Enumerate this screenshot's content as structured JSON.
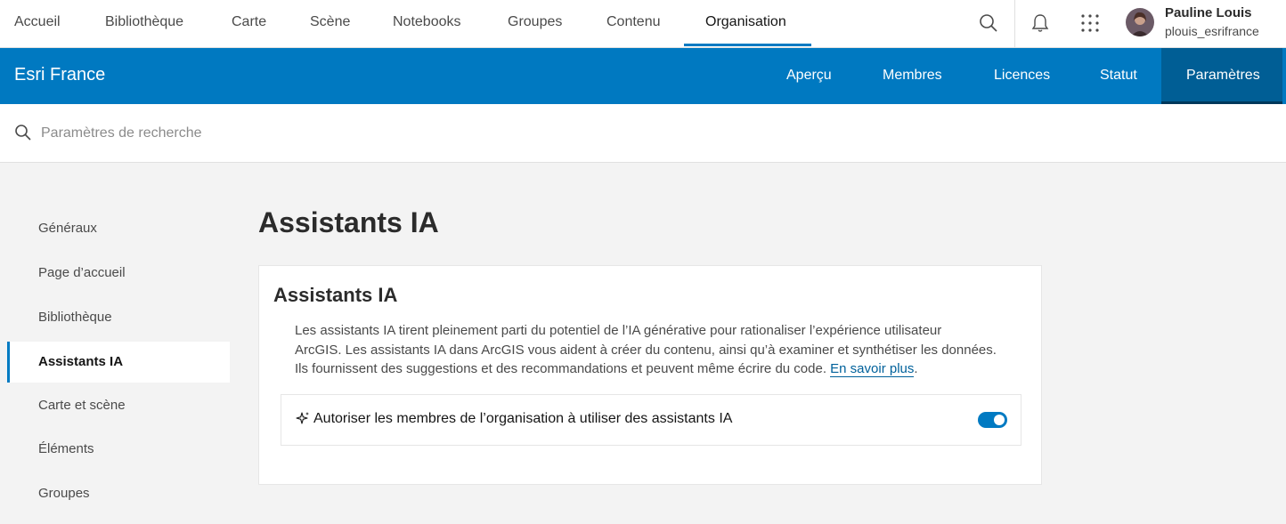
{
  "topnav": {
    "items": [
      {
        "label": "Accueil"
      },
      {
        "label": "Bibliothèque"
      },
      {
        "label": "Carte"
      },
      {
        "label": "Scène"
      },
      {
        "label": "Notebooks"
      },
      {
        "label": "Groupes"
      },
      {
        "label": "Contenu"
      },
      {
        "label": "Organisation",
        "active": true
      }
    ],
    "icons": [
      "search-icon",
      "bell-icon",
      "app-launcher-icon"
    ],
    "user": {
      "name": "Pauline Louis",
      "handle": "plouis_esrifrance"
    }
  },
  "org": {
    "title": "Esri France",
    "tabs": [
      {
        "label": "Aperçu"
      },
      {
        "label": "Membres"
      },
      {
        "label": "Licences"
      },
      {
        "label": "Statut"
      },
      {
        "label": "Paramètres",
        "active": true
      }
    ]
  },
  "search": {
    "placeholder": "Paramètres de recherche",
    "value": ""
  },
  "sidebar": {
    "items": [
      {
        "label": "Généraux"
      },
      {
        "label": "Page d’accueil"
      },
      {
        "label": "Bibliothèque"
      },
      {
        "label": "Assistants IA",
        "active": true
      },
      {
        "label": "Carte et scène"
      },
      {
        "label": "Éléments"
      },
      {
        "label": "Groupes"
      }
    ]
  },
  "main": {
    "title": "Assistants IA",
    "card": {
      "title": "Assistants IA",
      "desc_line1": "Les assistants IA tirent pleinement parti du potentiel de l’IA générative pour rationaliser l’expérience utilisateur",
      "desc_line2": "ArcGIS. Les assistants IA dans ArcGIS vous aident à créer du contenu, ainsi qu’à examiner et synthétiser les données.",
      "desc_line3": "Ils fournissent des suggestions et des recommandations et peuvent même écrire du code.",
      "learn_more": "En savoir plus",
      "period": ".",
      "setting_label": "Autoriser les membres de l’organisation à utiliser des assistants IA",
      "setting_enabled": true
    }
  },
  "colors": {
    "brand": "#0079c1",
    "accent": "#007ac2",
    "active_tab": "#005e95"
  }
}
